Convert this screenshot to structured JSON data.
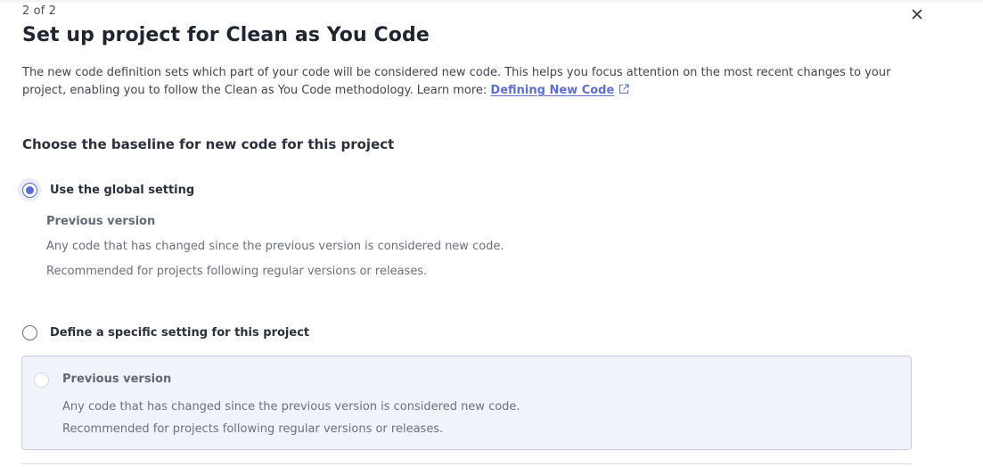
{
  "modal": {
    "step": "2 of 2",
    "title": "Set up project for Clean as You Code",
    "description": "The new code definition sets which part of your code will be considered new code. This helps you focus attention on the most recent changes to your project, enabling you to follow the Clean as You Code methodology. Learn more: ",
    "learn_more_link": "Defining New Code",
    "close_icon": "close-icon",
    "external_link_icon": "external-link-icon"
  },
  "baseline": {
    "heading": "Choose the baseline for new code for this project",
    "options": [
      {
        "label": "Use the global setting",
        "selected": true,
        "detail": {
          "title": "Previous version",
          "line1": "Any code that has changed since the previous version is considered new code.",
          "line2": "Recommended for projects following regular versions or releases."
        }
      },
      {
        "label": "Define a specific setting for this project",
        "selected": false,
        "choices": [
          {
            "title": "Previous version",
            "line1": "Any code that has changed since the previous version is considered new code.",
            "line2": "Recommended for projects following regular versions or releases.",
            "disabled": true
          }
        ]
      }
    ]
  },
  "colors": {
    "accent": "#5d6cd4",
    "link": "#5f6ed0",
    "card_background": "#f1f3fa",
    "card_border": "#c7ccdf"
  }
}
